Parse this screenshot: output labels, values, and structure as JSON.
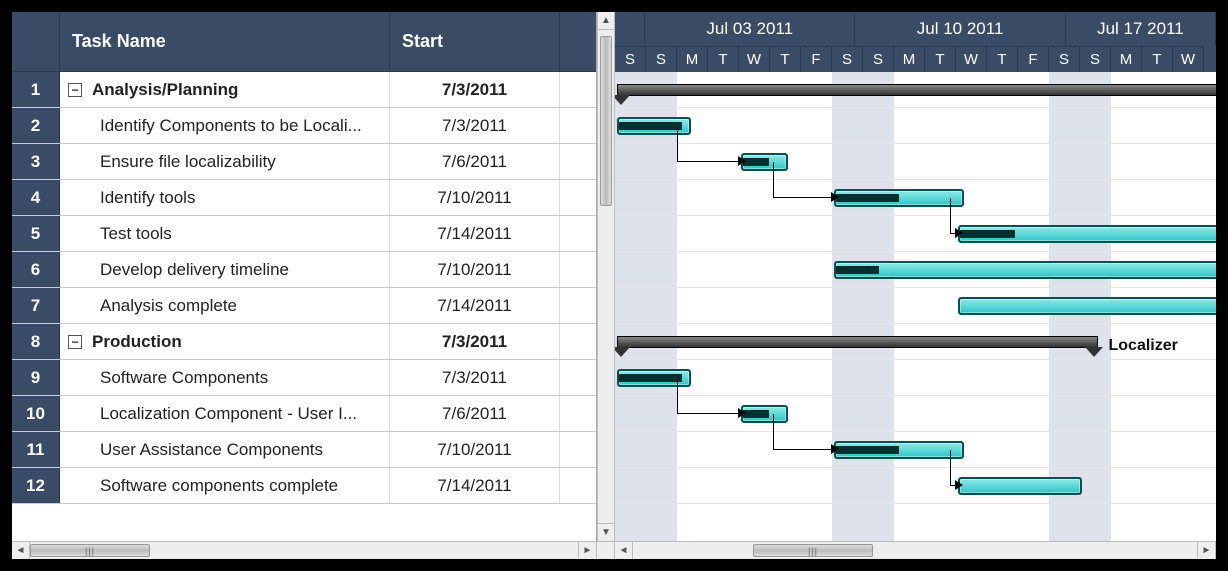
{
  "columns": {
    "name": "Task Name",
    "start": "Start"
  },
  "dayWidth": 31,
  "weeks": [
    {
      "label": "Jul 03 2011",
      "days": 7
    },
    {
      "label": "Jul 10 2011",
      "days": 7
    },
    {
      "label": "Jul 17 2011",
      "days": 5
    }
  ],
  "dayLetters": [
    "S",
    "S",
    "M",
    "T",
    "W",
    "T",
    "F",
    "S",
    "S",
    "M",
    "T",
    "W",
    "T",
    "F",
    "S",
    "S",
    "M",
    "T",
    "W"
  ],
  "weekendIdx": [
    0,
    1,
    7,
    8,
    14,
    15
  ],
  "tasks": [
    {
      "n": 1,
      "name": "Analysis/Planning",
      "start": "7/3/2011",
      "kind": "summary",
      "startDay": 0,
      "dur": 30,
      "indent": 0
    },
    {
      "n": 2,
      "name": "Identify Components to be Locali...",
      "start": "7/3/2011",
      "kind": "task",
      "startDay": 0,
      "dur": 2.4,
      "indent": 1,
      "progress": 0.9
    },
    {
      "n": 3,
      "name": "Ensure file localizability",
      "start": "7/6/2011",
      "kind": "task",
      "startDay": 4,
      "dur": 1.5,
      "indent": 1,
      "progress": 0.6,
      "dep": 2
    },
    {
      "n": 4,
      "name": "Identify tools",
      "start": "7/10/2011",
      "kind": "task",
      "startDay": 7,
      "dur": 4.2,
      "indent": 1,
      "progress": 0.5,
      "dep": 3
    },
    {
      "n": 5,
      "name": "Test tools",
      "start": "7/14/2011",
      "kind": "task",
      "startDay": 11,
      "dur": 12,
      "indent": 1,
      "progress": 0.15,
      "dep": 4
    },
    {
      "n": 6,
      "name": "Develop delivery timeline",
      "start": "7/10/2011",
      "kind": "task",
      "startDay": 7,
      "dur": 14,
      "indent": 1,
      "progress": 0.1
    },
    {
      "n": 7,
      "name": "Analysis complete",
      "start": "7/14/2011",
      "kind": "task",
      "startDay": 11,
      "dur": 12,
      "indent": 1,
      "progress": 0
    },
    {
      "n": 8,
      "name": "Production",
      "start": "7/3/2011",
      "kind": "summary",
      "startDay": 0,
      "dur": 15.5,
      "indent": 0,
      "label": "Localizer"
    },
    {
      "n": 9,
      "name": "Software Components",
      "start": "7/3/2011",
      "kind": "task",
      "startDay": 0,
      "dur": 2.4,
      "indent": 1,
      "progress": 0.9
    },
    {
      "n": 10,
      "name": "Localization Component - User I...",
      "start": "7/6/2011",
      "kind": "task",
      "startDay": 4,
      "dur": 1.5,
      "indent": 1,
      "progress": 0.6,
      "dep": 9
    },
    {
      "n": 11,
      "name": "User Assistance Components",
      "start": "7/10/2011",
      "kind": "task",
      "startDay": 7,
      "dur": 4.2,
      "indent": 1,
      "progress": 0.5,
      "dep": 10
    },
    {
      "n": 12,
      "name": "Software components complete",
      "start": "7/14/2011",
      "kind": "task",
      "startDay": 11,
      "dur": 4,
      "indent": 1,
      "progress": 0,
      "dep": 11
    }
  ],
  "chart_data": {
    "type": "gantt",
    "title": "",
    "time_axis": {
      "unit": "day",
      "start": "2011-07-02",
      "visible_days": 19
    },
    "tasks": [
      {
        "id": 1,
        "name": "Analysis/Planning",
        "start": "2011-07-03",
        "summary": true
      },
      {
        "id": 2,
        "name": "Identify Components to be Localized",
        "start": "2011-07-03",
        "duration_days": 2,
        "parent": 1
      },
      {
        "id": 3,
        "name": "Ensure file localizability",
        "start": "2011-07-06",
        "duration_days": 1,
        "parent": 1,
        "depends_on": [
          2
        ]
      },
      {
        "id": 4,
        "name": "Identify tools",
        "start": "2011-07-10",
        "duration_days": 4,
        "parent": 1,
        "depends_on": [
          3
        ]
      },
      {
        "id": 5,
        "name": "Test tools",
        "start": "2011-07-14",
        "duration_days": 12,
        "parent": 1,
        "depends_on": [
          4
        ]
      },
      {
        "id": 6,
        "name": "Develop delivery timeline",
        "start": "2011-07-10",
        "duration_days": 14,
        "parent": 1
      },
      {
        "id": 7,
        "name": "Analysis complete",
        "start": "2011-07-14",
        "parent": 1
      },
      {
        "id": 8,
        "name": "Production",
        "start": "2011-07-03",
        "summary": true,
        "resource": "Localizer"
      },
      {
        "id": 9,
        "name": "Software Components",
        "start": "2011-07-03",
        "duration_days": 2,
        "parent": 8
      },
      {
        "id": 10,
        "name": "Localization Component - User Interface",
        "start": "2011-07-06",
        "duration_days": 1,
        "parent": 8,
        "depends_on": [
          9
        ]
      },
      {
        "id": 11,
        "name": "User Assistance Components",
        "start": "2011-07-10",
        "duration_days": 4,
        "parent": 8,
        "depends_on": [
          10
        ]
      },
      {
        "id": 12,
        "name": "Software components complete",
        "start": "2011-07-14",
        "parent": 8,
        "depends_on": [
          11
        ]
      }
    ]
  }
}
